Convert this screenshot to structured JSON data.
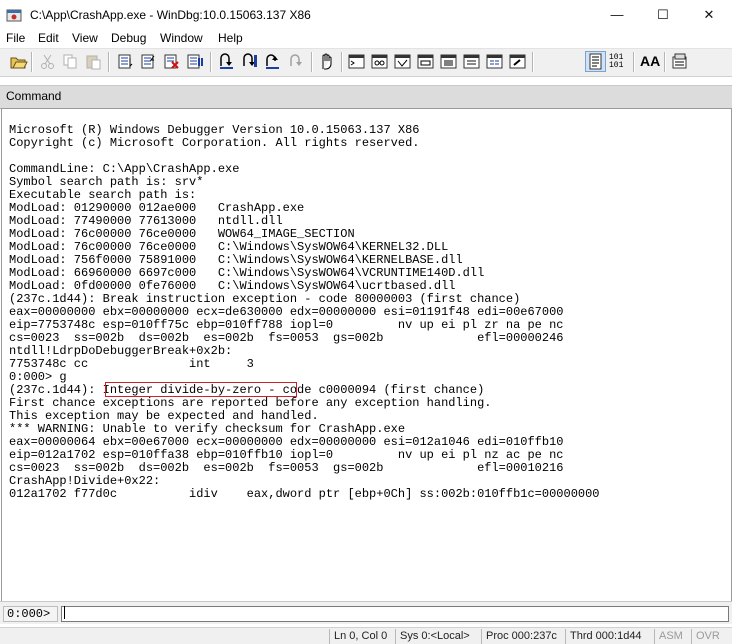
{
  "window": {
    "title": "C:\\App\\CrashApp.exe - WinDbg:10.0.15063.137 X86"
  },
  "window_controls": [
    "—",
    "☐",
    "✕"
  ],
  "menu": [
    "File",
    "Edit",
    "View",
    "Debug",
    "Window",
    "Help"
  ],
  "toolbar": {
    "icons": [
      "open-icon",
      "cut-icon",
      "copy-icon",
      "paste-icon",
      "step-over-source-icon",
      "step-into-source-icon",
      "stop-debugging-icon",
      "break-icon",
      "step-into-icon",
      "step-over-icon",
      "step-out-icon",
      "run-to-cursor-icon",
      "insert-breakpoint-icon",
      "command-window-icon",
      "watch-icon",
      "locals-icon",
      "registers-icon",
      "memory-icon",
      "call-stack-icon",
      "disassembly-icon",
      "scratch-pad-icon",
      "source-mode-icon",
      "hex-display-icon",
      "font-icon",
      "options-icon"
    ],
    "hex_label": "101\n101",
    "font_label": "AA"
  },
  "panel": {
    "title": "Command"
  },
  "output_lines": [
    "Microsoft (R) Windows Debugger Version 10.0.15063.137 X86",
    "Copyright (c) Microsoft Corporation. All rights reserved.",
    "",
    "CommandLine: C:\\App\\CrashApp.exe",
    "Symbol search path is: srv*",
    "Executable search path is:",
    "ModLoad: 01290000 012ae000   CrashApp.exe",
    "ModLoad: 77490000 77613000   ntdll.dll",
    "ModLoad: 76c00000 76ce0000   WOW64_IMAGE_SECTION",
    "ModLoad: 76c00000 76ce0000   C:\\Windows\\SysWOW64\\KERNEL32.DLL",
    "ModLoad: 756f0000 75891000   C:\\Windows\\SysWOW64\\KERNELBASE.dll",
    "ModLoad: 66960000 6697c000   C:\\Windows\\SysWOW64\\VCRUNTIME140D.dll",
    "ModLoad: 0fd00000 0fe76000   C:\\Windows\\SysWOW64\\ucrtbased.dll",
    "(237c.1d44): Break instruction exception - code 80000003 (first chance)",
    "eax=00000000 ebx=00000000 ecx=de630000 edx=00000000 esi=01191f48 edi=00e67000",
    "eip=7753748c esp=010ff75c ebp=010ff788 iopl=0         nv up ei pl zr na pe nc",
    "cs=0023  ss=002b  ds=002b  es=002b  fs=0053  gs=002b             efl=00000246",
    "ntdll!LdrpDoDebuggerBreak+0x2b:",
    "7753748c cc              int     3",
    "0:000> g",
    "(237c.1d44): Integer divide-by-zero - code c0000094 (first chance)",
    "First chance exceptions are reported before any exception handling.",
    "This exception may be expected and handled.",
    "*** WARNING: Unable to verify checksum for CrashApp.exe",
    "eax=00000064 ebx=00e67000 ecx=00000000 edx=00000000 esi=012a1046 edi=010ffb10",
    "eip=012a1702 esp=010ffa38 ebp=010ffb10 iopl=0         nv up ei pl nz ac pe nc",
    "cs=0023  ss=002b  ds=002b  es=002b  fs=0053  gs=002b             efl=00010216",
    "CrashApp!Divide+0x22:",
    "012a1702 f77d0c          idiv    eax,dword ptr [ebp+0Ch] ss:002b:010ffb1c=00000000"
  ],
  "command": {
    "prompt": "0:000>",
    "value": ""
  },
  "status": [
    "Ln 0, Col 0",
    "Sys 0:<Local>",
    "Proc 000:237c",
    "Thrd 000:1d44",
    "ASM",
    "OVR"
  ]
}
